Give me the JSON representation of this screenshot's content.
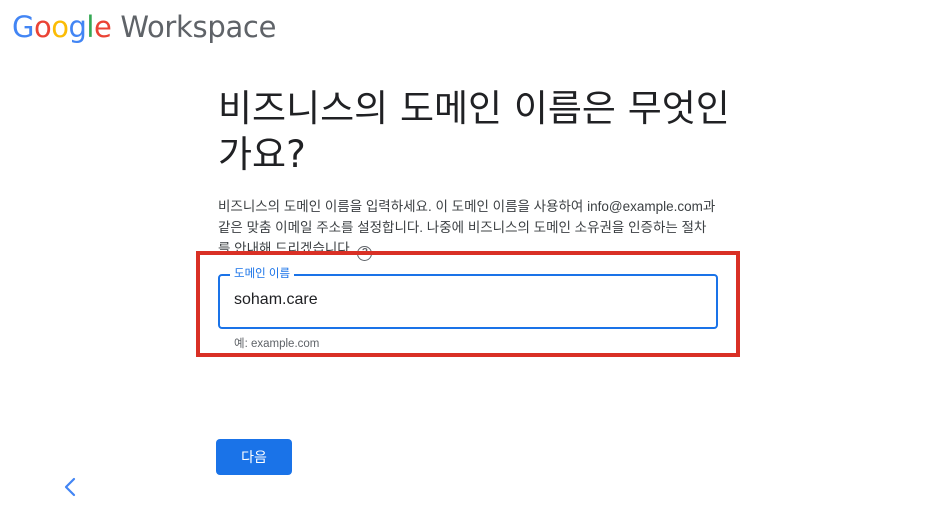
{
  "logo": {
    "google": [
      "G",
      "o",
      "o",
      "g",
      "l",
      "e"
    ],
    "product": "Workspace"
  },
  "title": "비즈니스의 도메인 이름은 무엇인가요?",
  "description": {
    "text": "비즈니스의 도메인 이름을 입력하세요. 이 도메인 이름을 사용하여 info@example.com과 같은 맞춤 이메일 주소를 설정합니다. 나중에 비즈니스의 도메인 소유권을 인증하는 절차를 안내해 드리겠습니다.",
    "help_icon": "help-circle-icon",
    "help_glyph": "?"
  },
  "domain_field": {
    "label": "도메인 이름",
    "value": "soham.care",
    "helper": "예: example.com"
  },
  "next_button": "다음",
  "back_icon": "chevron-left-icon",
  "colors": {
    "accent": "#1a73e8",
    "highlight": "#d93025",
    "google_blue": "#4285f4",
    "google_red": "#ea4335",
    "google_yellow": "#fbbc05",
    "google_green": "#34a853"
  }
}
